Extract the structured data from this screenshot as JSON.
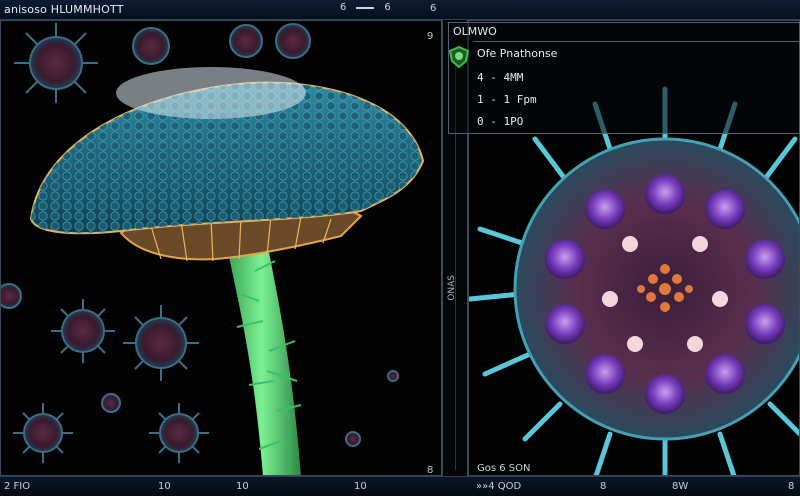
{
  "window": {
    "title": "anisoso HLUMMHOTT",
    "ctrl_left": "6",
    "ctrl_right": "6",
    "panel_num": "6"
  },
  "left_panel": {
    "corner_top_right": "9",
    "corner_bottom_right": "8"
  },
  "divider": {
    "vertical_text": "ONAS"
  },
  "right_panel": {
    "header": "OLMWO",
    "item_label": "Ofe Pnathonse",
    "rows": [
      "4 - 4MM",
      "1 - 1 Fpm",
      "0 - 1PO"
    ],
    "bottom_label": "Gos 6 SON"
  },
  "footer": {
    "items": [
      "2 FIO",
      "10",
      "10",
      "10",
      "»»4 QOD",
      "8",
      "8W",
      "8"
    ]
  },
  "colors": {
    "titlebar": "#0e1d34",
    "border": "#3d4a58",
    "accent_green": "#3fbf4a",
    "cap_teal": "#1f6f86",
    "stem_green": "#47c86c",
    "purple_cell": "#7a3fbf",
    "spike_cyan": "#58c8d8"
  },
  "icons": {
    "status_indicator": "green-shield-icon"
  }
}
